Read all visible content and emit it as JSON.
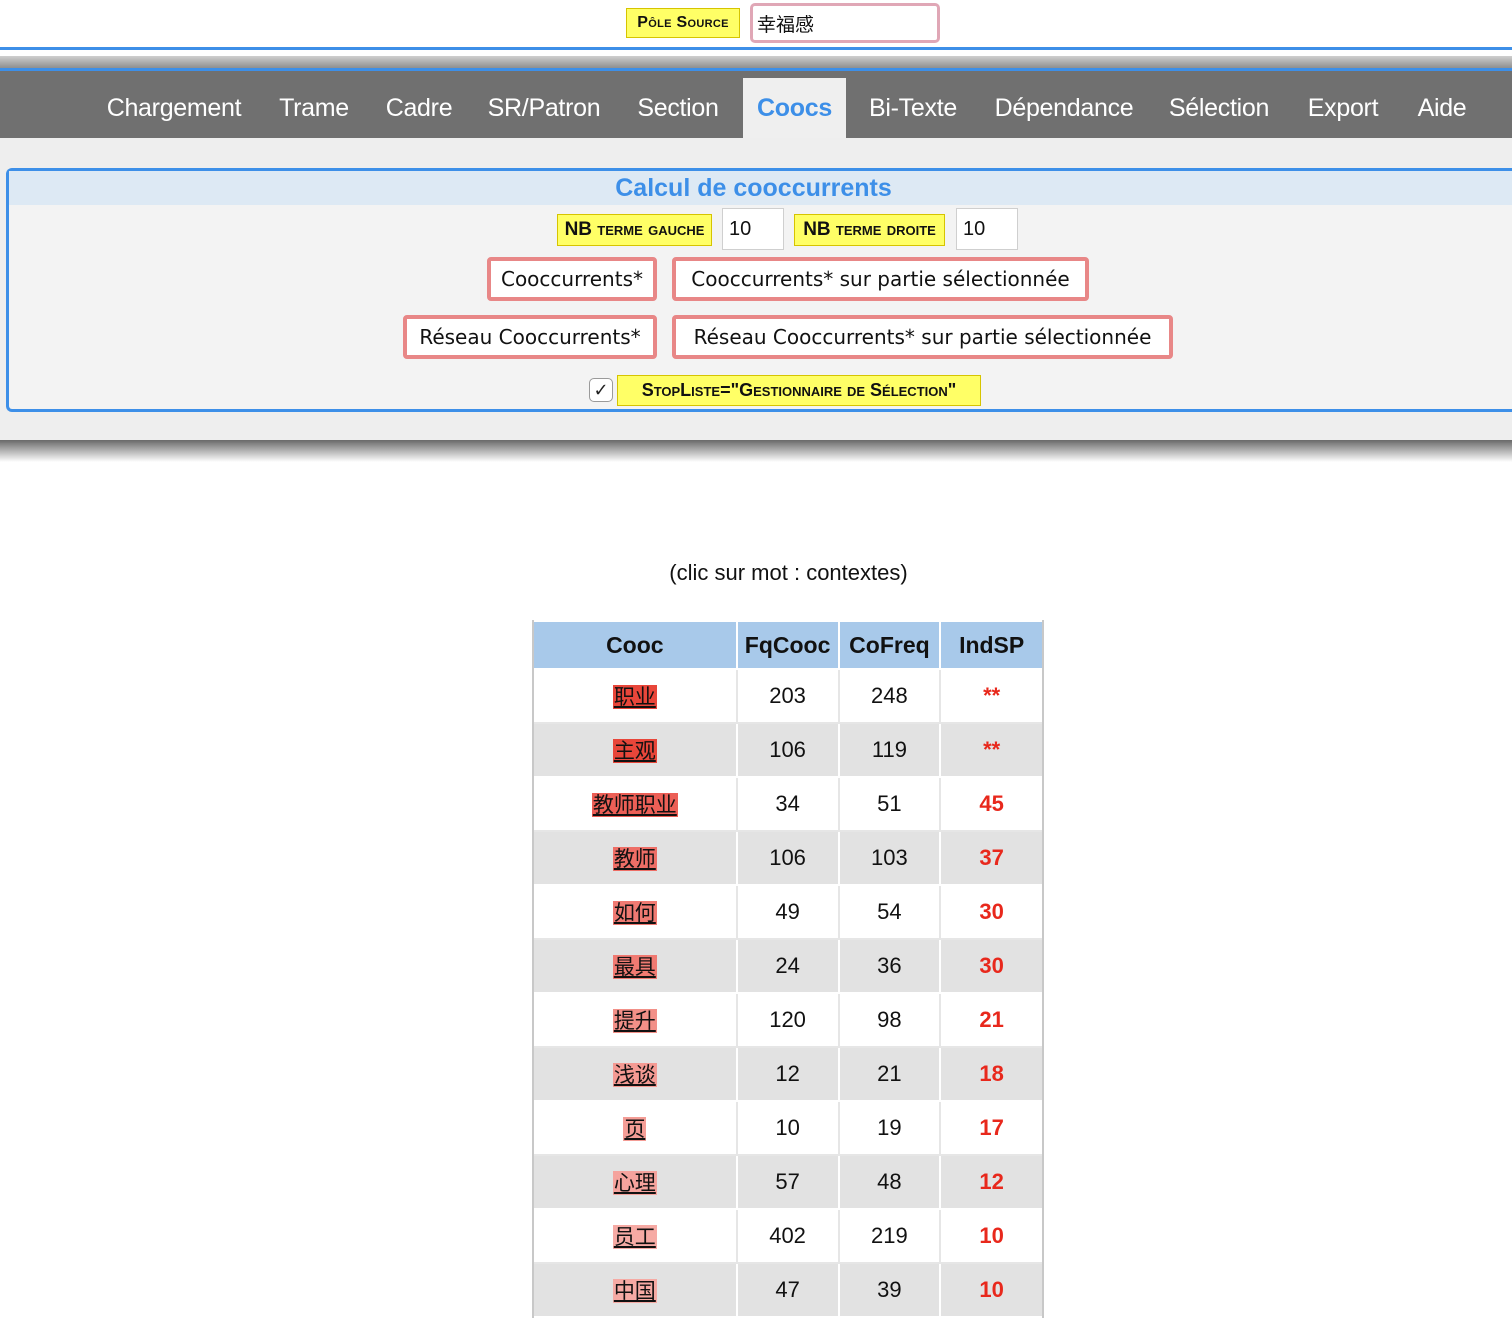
{
  "pole_source": {
    "label": "Pôle Source",
    "value": "幸福感"
  },
  "nav": {
    "items": [
      {
        "label": "Chargement",
        "active": false
      },
      {
        "label": "Trame",
        "active": false
      },
      {
        "label": "Cadre",
        "active": false
      },
      {
        "label": "SR/Patron",
        "active": false
      },
      {
        "label": "Section",
        "active": false
      },
      {
        "label": "Coocs",
        "active": true
      },
      {
        "label": "Bi-Texte",
        "active": false
      },
      {
        "label": "Dépendance",
        "active": false
      },
      {
        "label": "Sélection",
        "active": false
      },
      {
        "label": "Export",
        "active": false
      },
      {
        "label": "Aide",
        "active": false
      }
    ]
  },
  "panel": {
    "title": "Calcul de cooccurrents",
    "nb_left_label": "NB terme gauche",
    "nb_left_value": "10",
    "nb_right_label": "NB terme droite",
    "nb_right_value": "10",
    "btn_cooc": "Cooccurrents*",
    "btn_cooc_sel": "Cooccurrents* sur partie sélectionnée",
    "btn_reseau": "Réseau Cooccurrents*",
    "btn_reseau_sel": "Réseau Cooccurrents* sur partie sélectionnée",
    "stoplist_checked": true,
    "stoplist_check_glyph": "✓",
    "stoplist_label": "StopListe=\"Gestionnaire de Sélection\""
  },
  "hint": "(clic sur mot : contextes)",
  "table": {
    "headers": [
      "Cooc",
      "FqCooc",
      "CoFreq",
      "IndSP"
    ],
    "rows": [
      {
        "word": "职业",
        "fq": "203",
        "cofreq": "248",
        "ind": "**",
        "color": "#e8463a"
      },
      {
        "word": "主观",
        "fq": "106",
        "cofreq": "119",
        "ind": "**",
        "color": "#e8463a"
      },
      {
        "word": "教师职业",
        "fq": "34",
        "cofreq": "51",
        "ind": "45",
        "color": "#ec5f56"
      },
      {
        "word": "教师",
        "fq": "106",
        "cofreq": "103",
        "ind": "37",
        "color": "#ee6e66"
      },
      {
        "word": "如何",
        "fq": "49",
        "cofreq": "54",
        "ind": "30",
        "color": "#f07a72"
      },
      {
        "word": "最具",
        "fq": "24",
        "cofreq": "36",
        "ind": "30",
        "color": "#f07a72"
      },
      {
        "word": "提升",
        "fq": "120",
        "cofreq": "98",
        "ind": "21",
        "color": "#f29088"
      },
      {
        "word": "浅谈",
        "fq": "12",
        "cofreq": "21",
        "ind": "18",
        "color": "#f49a93"
      },
      {
        "word": "页",
        "fq": "10",
        "cofreq": "19",
        "ind": "17",
        "color": "#f49d96"
      },
      {
        "word": "心理",
        "fq": "57",
        "cofreq": "48",
        "ind": "12",
        "color": "#f5a39d"
      },
      {
        "word": "员工",
        "fq": "402",
        "cofreq": "219",
        "ind": "10",
        "color": "#f6aaa4"
      },
      {
        "word": "中国",
        "fq": "47",
        "cofreq": "39",
        "ind": "10",
        "color": "#f6aaa4"
      }
    ]
  }
}
